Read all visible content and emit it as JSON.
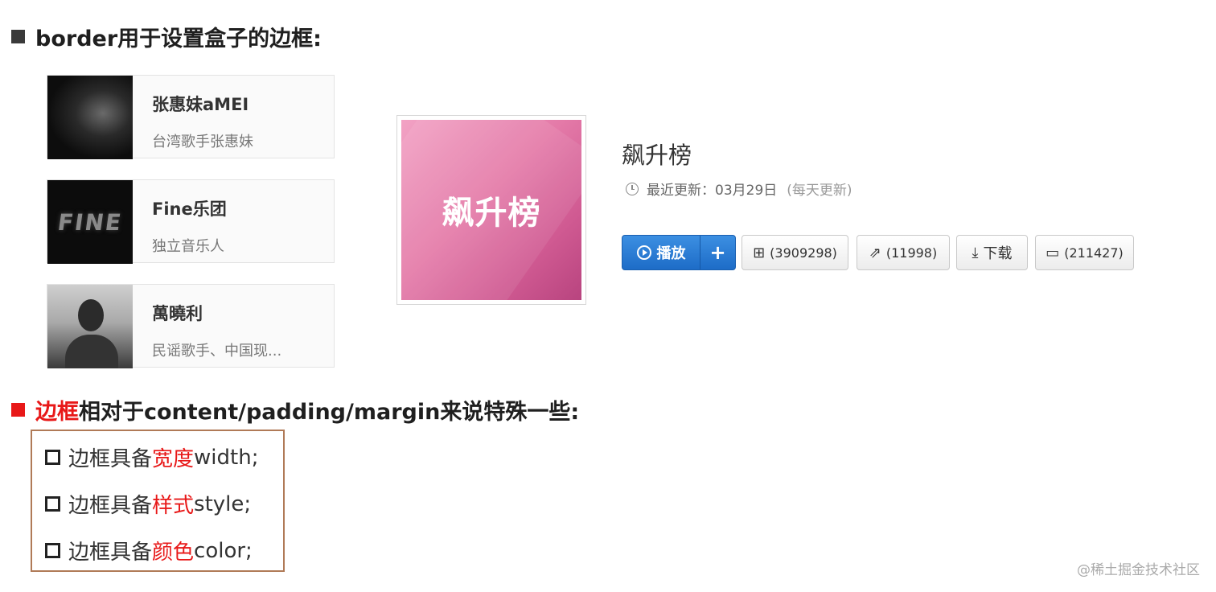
{
  "heading1": {
    "text": "border用于设置盒子的边框:"
  },
  "artists": [
    {
      "name": "张惠妹aMEI",
      "desc": "台湾歌手张惠妹"
    },
    {
      "name": "Fine乐团",
      "desc": "独立音乐人",
      "photo_text": "FINE"
    },
    {
      "name": "萬曉利",
      "desc": "民谣歌手、中国现..."
    }
  ],
  "playlist": {
    "cover_text": "飙升榜",
    "title": "飙升榜",
    "update_label": "最近更新：03月29日",
    "update_freq": "(每天更新)",
    "play_label": "播放",
    "add_label": "+",
    "collect_label": "(3909298)",
    "share_label": "(11998)",
    "download_label": "下载",
    "comment_label": "(211427)"
  },
  "heading2": {
    "highlight": "边框",
    "rest": "相对于content/padding/margin来说特殊一些:"
  },
  "border_items": [
    {
      "prefix": "边框具备",
      "highlight": "宽度",
      "suffix": "width;"
    },
    {
      "prefix": "边框具备",
      "highlight": "样式",
      "suffix": "style;"
    },
    {
      "prefix": "边框具备",
      "highlight": "颜色",
      "suffix": "color;"
    }
  ],
  "watermark": "@稀土掘金技术社区",
  "colors": {
    "highlight_red": "#e81818",
    "play_blue": "#1d6cc7",
    "cover_pink": "#e47aa8",
    "box_border": "#b07a57"
  }
}
